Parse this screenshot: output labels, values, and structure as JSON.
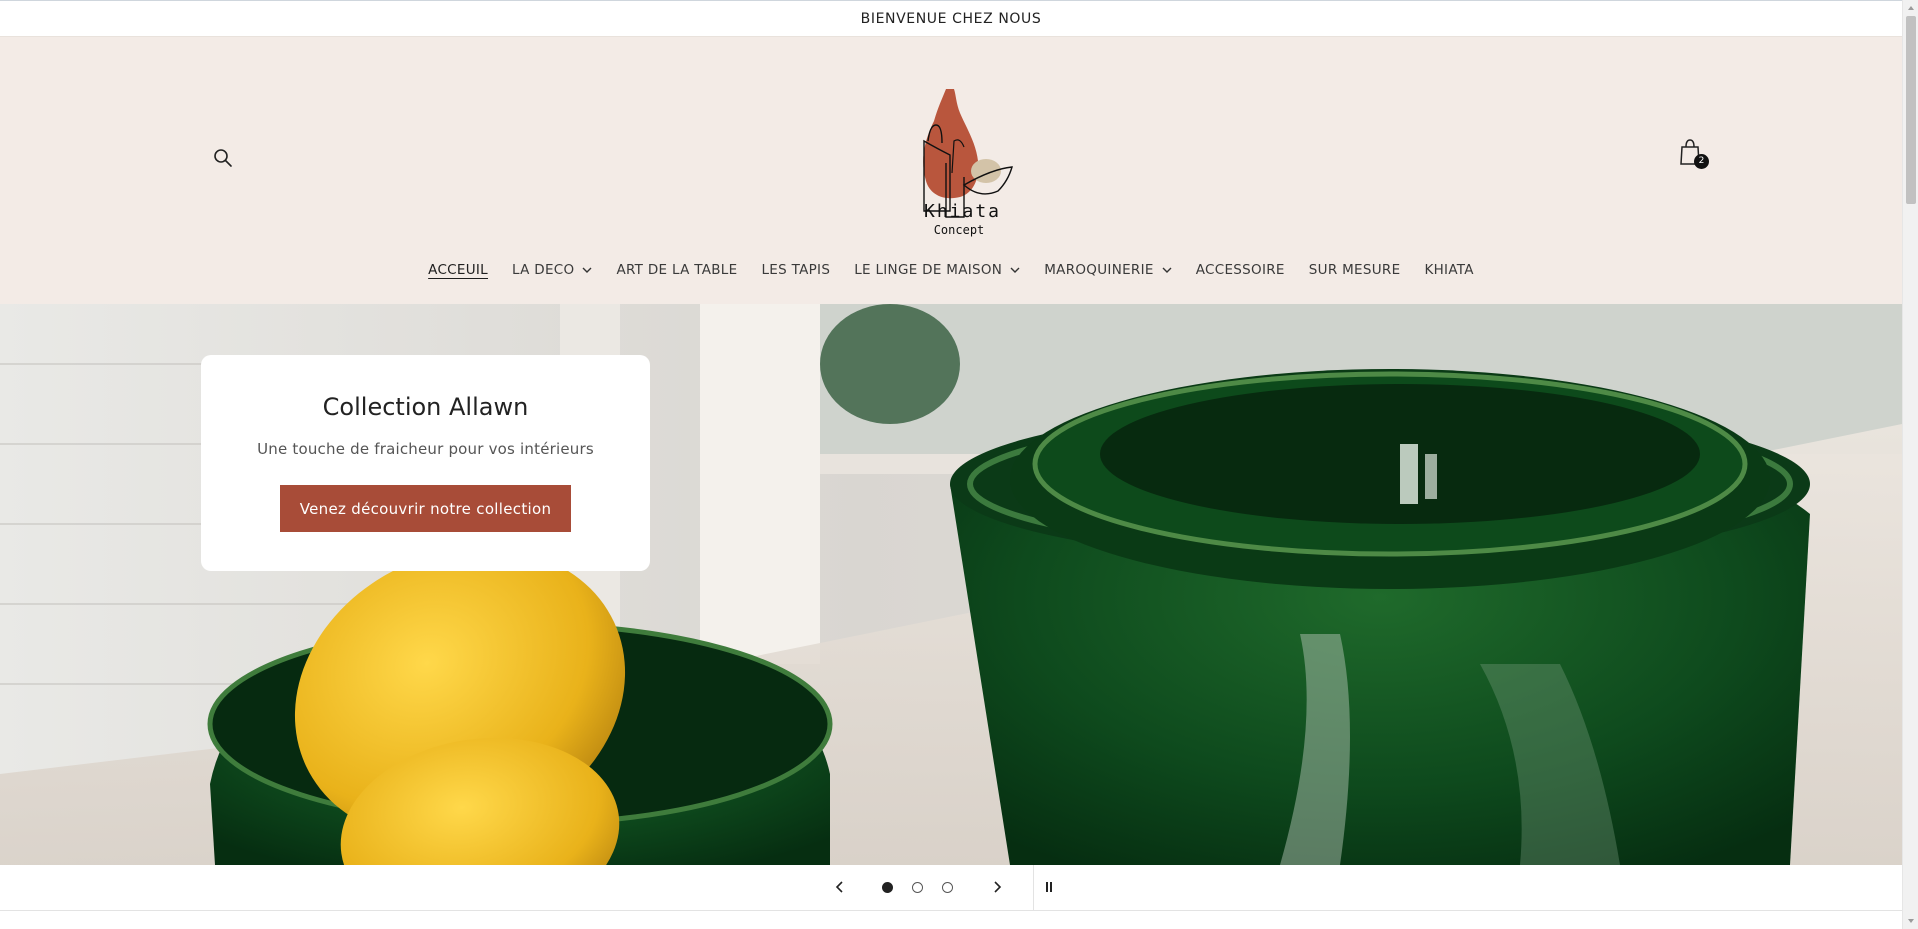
{
  "announcement": {
    "text": "BIENVENUE CHEZ NOUS"
  },
  "header": {
    "search_icon": "search-icon",
    "cart_icon": "shopping-bag-icon",
    "cart_count": "2",
    "logo": {
      "line1": "Khiata",
      "line2": "Concept"
    }
  },
  "nav": {
    "items": [
      {
        "label": "ACCEUIL",
        "has_dropdown": false,
        "active": true
      },
      {
        "label": "LA DECO",
        "has_dropdown": true
      },
      {
        "label": "ART DE LA TABLE",
        "has_dropdown": false
      },
      {
        "label": "LES TAPIS",
        "has_dropdown": false
      },
      {
        "label": "LE LINGE DE MAISON",
        "has_dropdown": true
      },
      {
        "label": "MAROQUINERIE",
        "has_dropdown": true
      },
      {
        "label": "ACCESSOIRE",
        "has_dropdown": false
      },
      {
        "label": "SUR MESURE",
        "has_dropdown": false
      },
      {
        "label": "KHIATA",
        "has_dropdown": false
      }
    ]
  },
  "hero": {
    "title": "Collection Allawn",
    "subtitle": "Une touche de fraicheur pour vos intérieurs",
    "cta": "Venez découvrir notre collection"
  },
  "slider": {
    "prev_icon": "chevron-left-icon",
    "next_icon": "chevron-right-icon",
    "pause_icon": "pause-icon",
    "slide_count": 3,
    "active_slide": 1
  },
  "colors": {
    "header_bg": "#f3ebe6",
    "accent": "#a84c38",
    "logo_terracotta": "#b9563d",
    "logo_beige": "#d3c3a8"
  }
}
